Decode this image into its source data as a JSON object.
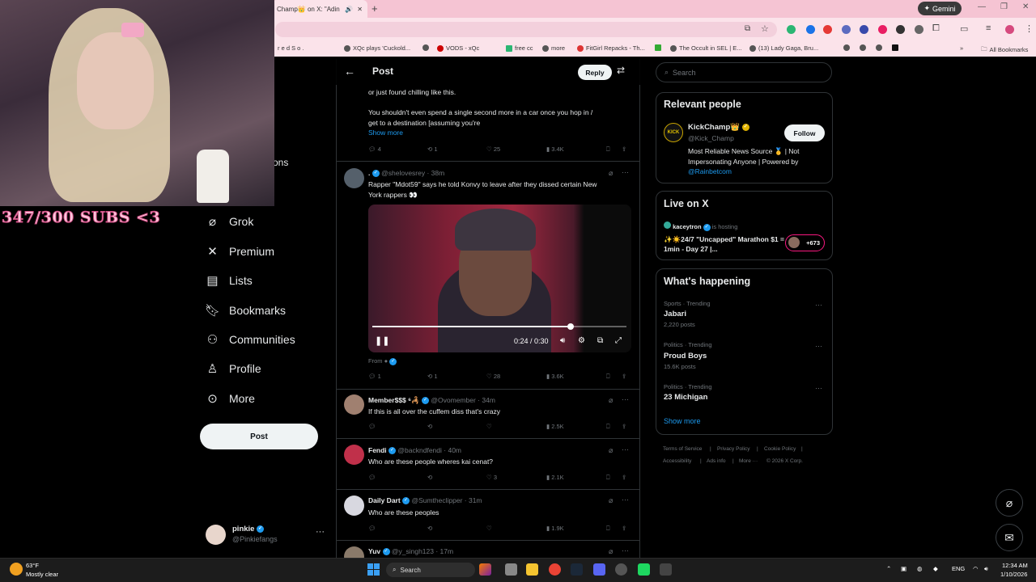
{
  "browser": {
    "tab_title": "Champ👑 on X: \"Adin R",
    "gemini_label": "Gemini",
    "bookmarks": [
      "r e d   S o .",
      "XQc plays 'Cuckold...",
      "",
      "VODS - xQc",
      "free cc",
      "more",
      "FitGirl Repacks - Th...",
      "",
      "The Occult in SEL | E...",
      "(13) Lady Gaga, Bru..."
    ],
    "all_bookmarks": "All Bookmarks"
  },
  "stream": {
    "subs_text": "347/300 SUBS <3",
    "partial_nav": "ons"
  },
  "nav": {
    "items": [
      {
        "label": "Grok",
        "icon": "grok-icon"
      },
      {
        "label": "Premium",
        "icon": "x-logo-icon"
      },
      {
        "label": "Lists",
        "icon": "list-icon"
      },
      {
        "label": "Bookmarks",
        "icon": "bookmark-icon"
      },
      {
        "label": "Communities",
        "icon": "communities-icon"
      },
      {
        "label": "Profile",
        "icon": "person-icon"
      },
      {
        "label": "More",
        "icon": "more-circle-icon"
      }
    ],
    "post_button": "Post",
    "account": {
      "name": "pinkie",
      "handle": "@Pinkiefangs"
    }
  },
  "header": {
    "title": "Post",
    "reply_button": "Reply"
  },
  "top_post": {
    "line0": "or just found chilling like this.",
    "line1": "You shouldn't even spend a single second more in a car once you hop in /",
    "line2": "get to a destination [assuming you're",
    "show_more": "Show more",
    "replies": "4",
    "reposts": "1",
    "likes": "25",
    "views": "3.4K"
  },
  "tweets": [
    {
      "name": ".",
      "handle": "@shelovesrey",
      "time": "38m",
      "text1": "Rapper \"Mdot59\" says he told Konvy to leave after they dissed certain New",
      "text2": "York rappers 👀",
      "from": "From",
      "replies": "1",
      "reposts": "1",
      "likes": "28",
      "views": "3.6K"
    },
    {
      "name": "Member$$$ ⁶🦂",
      "handle": "@Ovomember",
      "time": "34m",
      "text": "If this is all over the cuffem diss that's crazy",
      "replies": "",
      "reposts": "",
      "likes": "",
      "views": "2.5K"
    },
    {
      "name": "Fendi",
      "handle": "@backndfendi",
      "time": "40m",
      "text": "Who are these people wheres kai cenat?",
      "replies": "",
      "reposts": "",
      "likes": "3",
      "views": "2.1K"
    },
    {
      "name": "Daily Dart",
      "handle": "@Sumtheclipper",
      "time": "31m",
      "text": "Who are these peoples",
      "replies": "",
      "reposts": "",
      "likes": "",
      "views": "1.9K"
    },
    {
      "name": "Yuv",
      "handle": "@y_singh123",
      "time": "17m"
    }
  ],
  "video": {
    "time": "0:24 / 0:30",
    "progress": 0.78
  },
  "sidebar": {
    "search_placeholder": "Search",
    "relevant_title": "Relevant people",
    "kick": {
      "avatar_text": "KICK",
      "name": "KickChamp👑",
      "handle": "@Kick_Champ",
      "bio1": "Most Reliable News Source 🥇 | Not",
      "bio2": "Impersonating Anyone | Powered by",
      "bio_link": "@Rainbetcom",
      "follow": "Follow"
    },
    "live_title": "Live on X",
    "live": {
      "host": "kaceytron",
      "hosting": "is hosting",
      "title": "✨☀️24/7 \"Uncapped\" Marathon $1 = 1min - Day 27 |...",
      "viewers": "+673"
    },
    "happening_title": "What's happening",
    "trends": [
      {
        "category": "Sports · Trending",
        "name": "Jabari",
        "count": "2,220 posts"
      },
      {
        "category": "Politics · Trending",
        "name": "Proud Boys",
        "count": "15.6K posts"
      },
      {
        "category": "Politics · Trending",
        "name": "23 Michigan",
        "count": ""
      }
    ],
    "show_more": "Show more",
    "footer": [
      "Terms of Service",
      "|",
      "Privacy Policy",
      "|",
      "Cookie Policy",
      "|",
      "Accessibility",
      "|",
      "Ads info",
      "|",
      "More ···",
      "© 2026 X Corp."
    ]
  },
  "taskbar": {
    "temp": "63°F",
    "weather": "Mostly clear",
    "search": "Search",
    "lang": "ENG",
    "time": "12:34 AM",
    "date": "1/10/2026"
  }
}
